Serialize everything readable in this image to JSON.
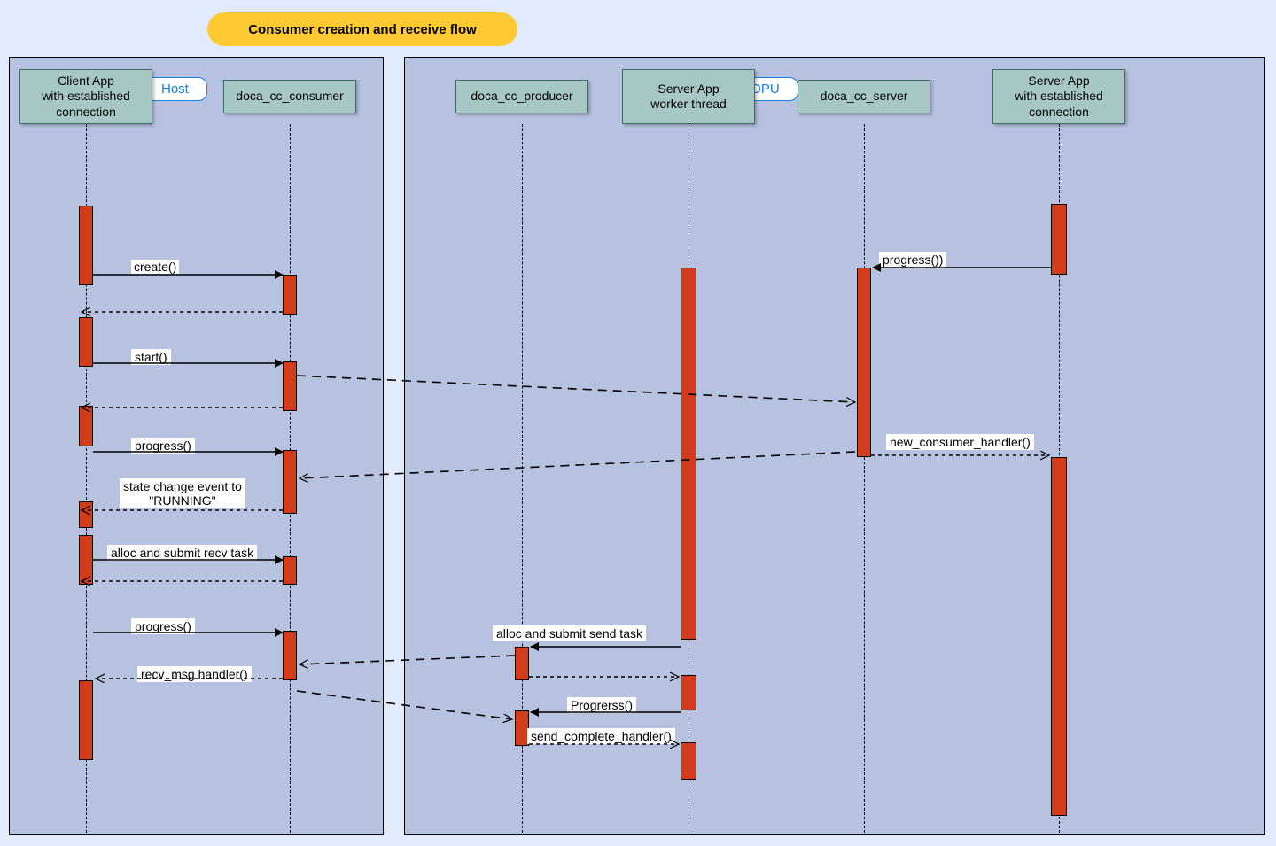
{
  "title": "Consumer creation and receive flow",
  "panels": {
    "host": "Host",
    "dpu": "DPU"
  },
  "participants": {
    "client": "Client App\nwith established\nconnection",
    "consumer": "doca_cc_consumer",
    "producer": "doca_cc_producer",
    "worker": "Server App\nworker thread",
    "server": "doca_cc_server",
    "serverapp": "Server App\nwith established\nconnection"
  },
  "labels": {
    "create": "create()",
    "start": "start()",
    "progress_top_right": "progress())",
    "progress1": "progress()",
    "state_change": "state change event to\n\"RUNNING\"",
    "new_consumer": "new_consumer_handler()",
    "alloc_recv": "alloc and submit recv task",
    "progress2": "progress()",
    "recv_msg": "recv_msg handler()",
    "alloc_send": "alloc and submit send task",
    "progresss": "Progrerss()",
    "send_complete": "send_complete_handler()"
  }
}
